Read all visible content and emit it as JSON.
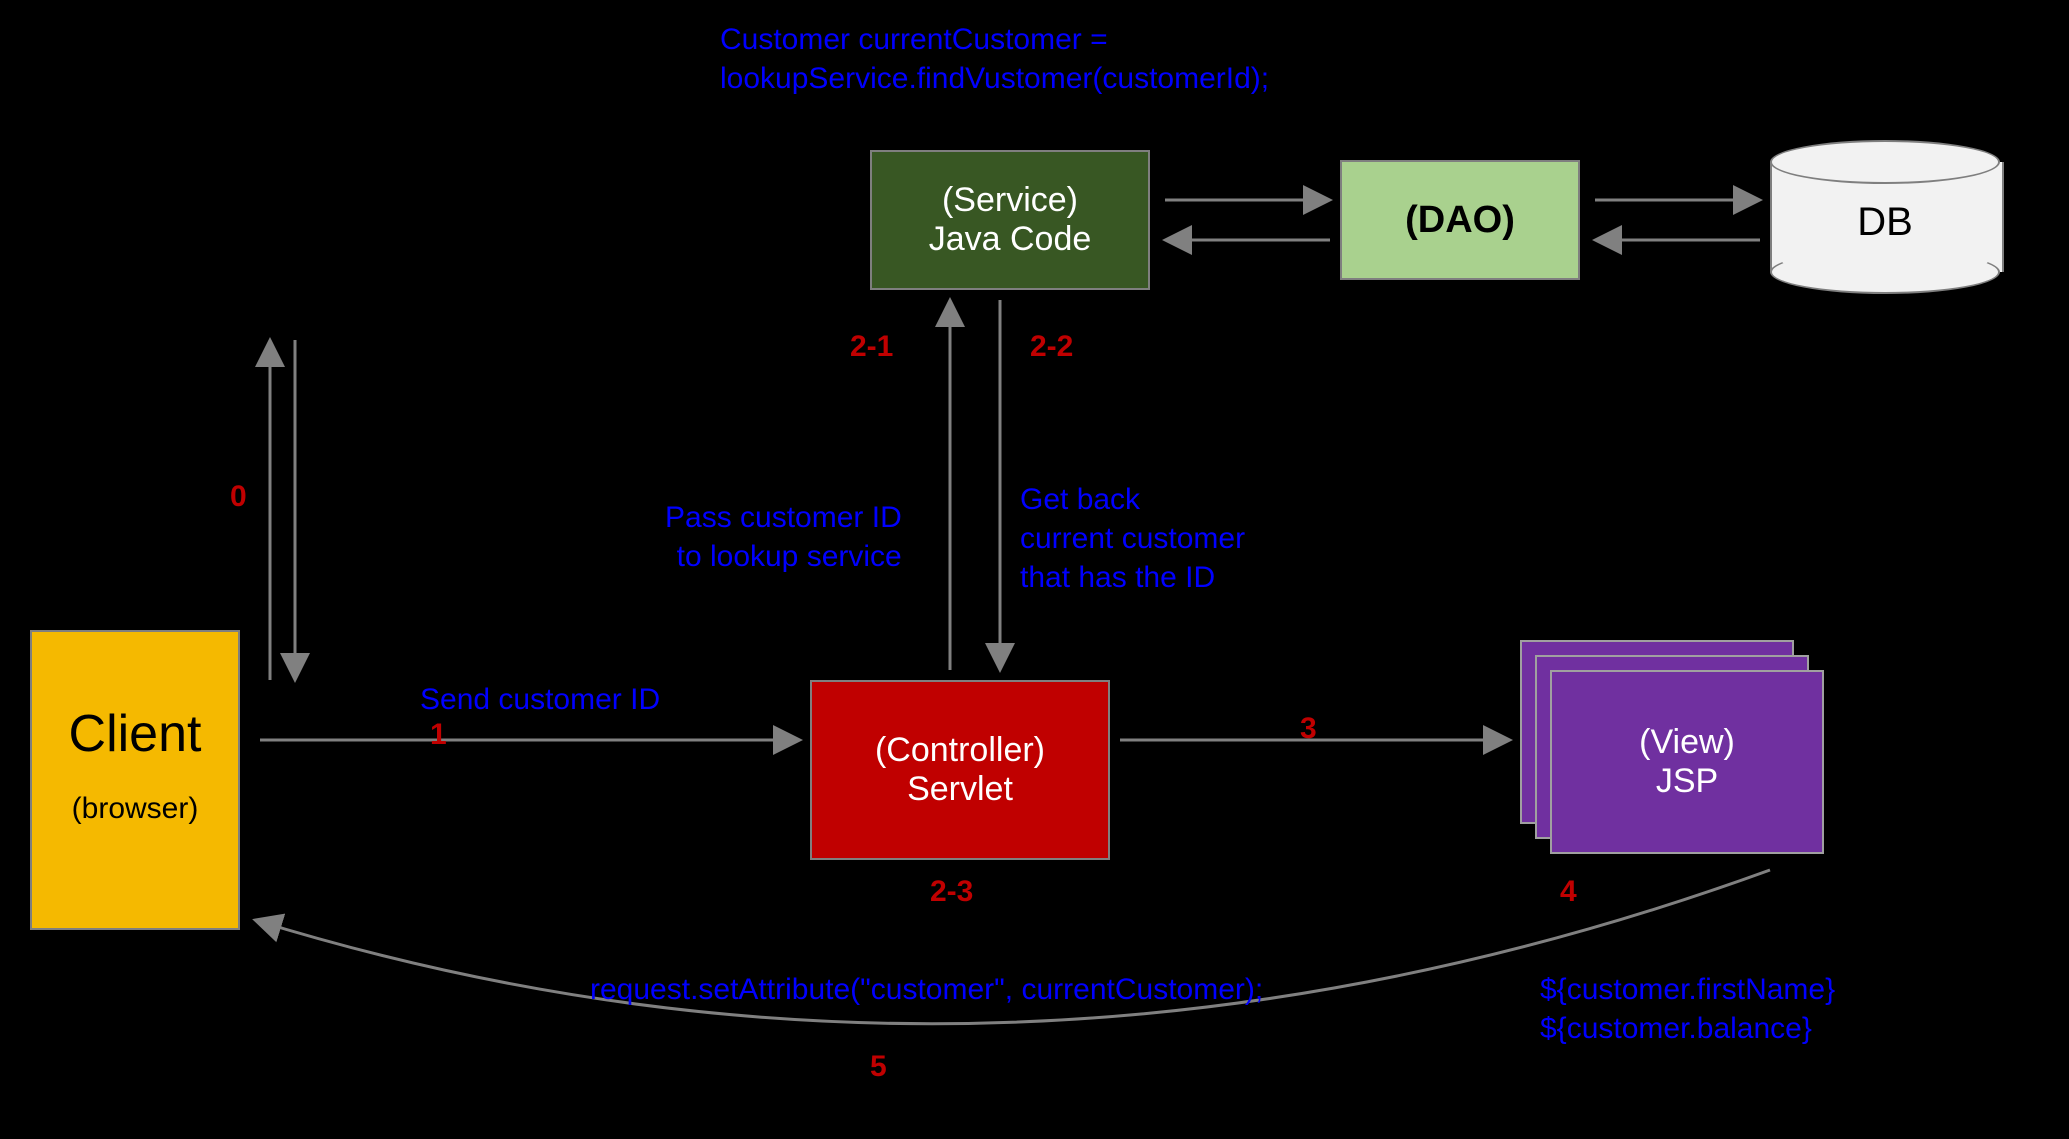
{
  "nodes": {
    "client": {
      "title": "Client",
      "sub": "(browser)"
    },
    "controller": {
      "title": "(Controller)",
      "sub": "Servlet"
    },
    "service": {
      "title": "(Service)",
      "sub": "Java Code"
    },
    "dao": {
      "title": "(DAO)"
    },
    "db": {
      "title": "DB"
    },
    "view": {
      "title": "(View)",
      "sub": "JSP"
    }
  },
  "steps": {
    "s0": "0",
    "s1": "1",
    "s2_1": "2-1",
    "s2_2": "2-2",
    "s2_3": "2-3",
    "s3": "3",
    "s4": "4",
    "s5": "5"
  },
  "code": {
    "top": "Customer currentCustomer =\nlookupService.findVustomer(customerId);",
    "send": "Send customer ID",
    "pass": "Pass customer ID\nto lookup service",
    "getback": "Get back\ncurrent customer\nthat has the ID",
    "setattr": "request.setAttribute(\"customer\", currentCustomer);",
    "jsp": "${customer.firstName}\n${customer.balance}"
  }
}
